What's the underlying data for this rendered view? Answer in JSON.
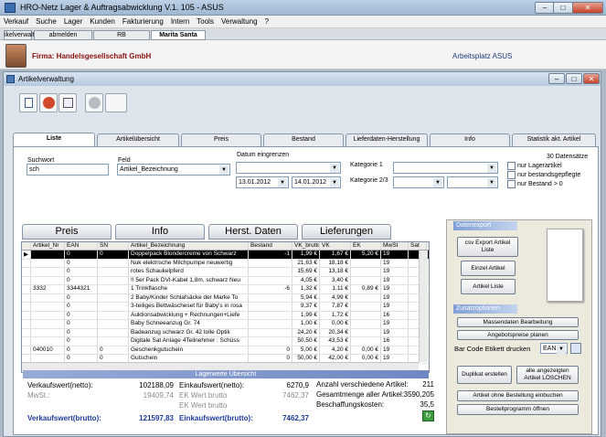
{
  "app": {
    "title": "HRO-Netz Lager & Auftragsabwicklung  V.1. 105  -  ASUS"
  },
  "menu": [
    "Verkauf",
    "Suche",
    "Lager",
    "Kunden",
    "Fakturierung",
    "Intern",
    "Tools",
    "Verwaltung",
    "?"
  ],
  "user_tabs": {
    "left": "ikelverwaltu",
    "items": [
      "abmelden",
      "RB",
      "Marita Santa"
    ]
  },
  "firma": "Firma: Handelsgesellschaft GmbH",
  "arbeitsplatz": "Arbeitsplatz  ASUS",
  "inner": {
    "title": "Artikelverwaltung"
  },
  "tabs": [
    "Liste",
    "Artikelübersicht",
    "Preis",
    "Bestand",
    "Lieferdaten-Herstellung",
    "Info",
    "Statistik akt. Artikel"
  ],
  "search": {
    "suchwort_label": "Suchwort",
    "suchwort_value": "sch",
    "feld_label": "Feld",
    "feld_value": "Artikel_Bezeichnung",
    "datum_label": "Datum eingrenzen",
    "datum_from": "13.01.2012",
    "datum_to": "14.01.2012",
    "kategorie1_label": "Kategorie 1",
    "kategorie23_label": "Kategorie 2/3",
    "count_label": "30  Datensätze",
    "checkboxes": [
      "nur Lagerartikel",
      "nur bestandsgepflegte",
      "nur Bestand > 0"
    ]
  },
  "big_tabs": [
    "Preis",
    "Info",
    "Herst. Daten",
    "Lieferungen"
  ],
  "grid": {
    "columns": [
      "Artikel_Nr",
      "EAN",
      "SN",
      "Artikel_Bezeichnung",
      "Bestand",
      "VK_brutto",
      "VK",
      "EK",
      "MwSt",
      "Sat"
    ],
    "rows": [
      [
        "",
        "0",
        "0",
        "Doppelpack Blondercreme von Schwarz",
        "-1",
        "1,99 €",
        "1,67 €",
        "5,20 €",
        "19"
      ],
      [
        "",
        "0",
        "",
        "Nuk elektrische Milchpumpe neuwertig",
        "",
        "21,63 €",
        "18,18 €",
        "",
        "19"
      ],
      [
        "",
        "0",
        "",
        "rotes Schaukelpferd",
        "",
        "15,69 €",
        "13,18 €",
        "",
        "19"
      ],
      [
        "",
        "0",
        "",
        "!! 5er Pack DVI-Kabel 1,8m. schwarz Neu",
        "",
        "4,05 €",
        "3,40 €",
        "",
        "19"
      ],
      [
        "3332",
        "3344321",
        "",
        "1 Trinkflasche",
        "-6",
        "1,32 €",
        "1,11 €",
        "0,89 €",
        "19"
      ],
      [
        "",
        "0",
        "",
        "2 Baby/Kinder Schlafsäcke der Marke To",
        "",
        "5,94 €",
        "4,99 €",
        "",
        "19"
      ],
      [
        "",
        "0",
        "",
        "3-teiliges Bettwäscheset für Baby's in rosa",
        "",
        "9,37 €",
        "7,87 €",
        "",
        "19"
      ],
      [
        "",
        "0",
        "",
        "Auktionsabwicklung + Rechnungen+Liefe",
        "",
        "1,99 €",
        "1,72 €",
        "",
        "16"
      ],
      [
        "",
        "0",
        "",
        "Baby Schneeanzug Gr. 74",
        "",
        "1,00 €",
        "0,00 €",
        "",
        "19"
      ],
      [
        "",
        "0",
        "",
        "Badeanzug schwarz Gr. 42 tolle Optik",
        "",
        "24,20 €",
        "20,34 €",
        "",
        "19"
      ],
      [
        "",
        "0",
        "",
        "Digitale Sat Anlage 4Teilnehmer : Schüss",
        "",
        "50,50 €",
        "43,53 €",
        "",
        "16"
      ],
      [
        "040010",
        "0",
        "0",
        "Geschenkgutschein",
        "0",
        "5,00 €",
        "4,20 €",
        "0,00 €",
        "19"
      ],
      [
        "",
        "0",
        "0",
        "Gutschein",
        "0",
        "50,00 €",
        "42,00 €",
        "0,00 €",
        "19"
      ]
    ]
  },
  "lagerwerte_title": "Lagerwerte Übersicht",
  "summary": {
    "vk_netto_label": "Verkaufswert(netto):",
    "vk_netto_value": "102188,09",
    "mwst_label": "MwSt.:",
    "mwst_value": "19409,74",
    "vk_brutto_label": "Verkaufswert(brutto):",
    "vk_brutto_value": "121597,83",
    "ek_netto_label": "Einkaufswert(netto):",
    "ek_netto_value": "6270,9",
    "ek_wert_brutto_label": "EK Wert brutto",
    "ek_wert_brutto_value": "7462,37",
    "ek_wert_brutto2_label": "EK Wert brutto",
    "ek_wert_brutto2_value": "",
    "ek_brutto_label": "Einkaufswert(brutto):",
    "ek_brutto_value": "7462,37",
    "anzahl_label": "Anzahl verschiedene Artikel:",
    "anzahl_value": "211",
    "gesamt_label": "Gesamtmenge aller Artikel:",
    "gesamt_value": "3590,205",
    "beschaffung_label": "Beschaffungskosten:",
    "beschaffung_value": "35,5"
  },
  "side": {
    "datenexport_label": "Datenexport",
    "csv_label": "csv Export Artikel Liste",
    "einzel_label": "Einzel Artikel",
    "artikel_liste_label": "Artikel Liste",
    "zusatz_label": "Zusatzoptionen",
    "massendaten_label": "Massendaten Bearbeitung",
    "angebot_label": "Angebotspreise planen",
    "barcode_label": "Bar Code Etikett drucken",
    "barcode_type": "EAN",
    "duplikat_label": "Duplikat erstellen",
    "loeschen_label": "alle angezeigten Artikel LÖSCHEN",
    "ohne_bestellung_label": "Artikel ohne Bestellung einbuchen",
    "bestellprogramm_label": "Bestellprogramm öffnen"
  },
  "colors": {
    "accent": "#1d3d9a",
    "selected_row": "#000000",
    "firm": "#8a1010"
  }
}
